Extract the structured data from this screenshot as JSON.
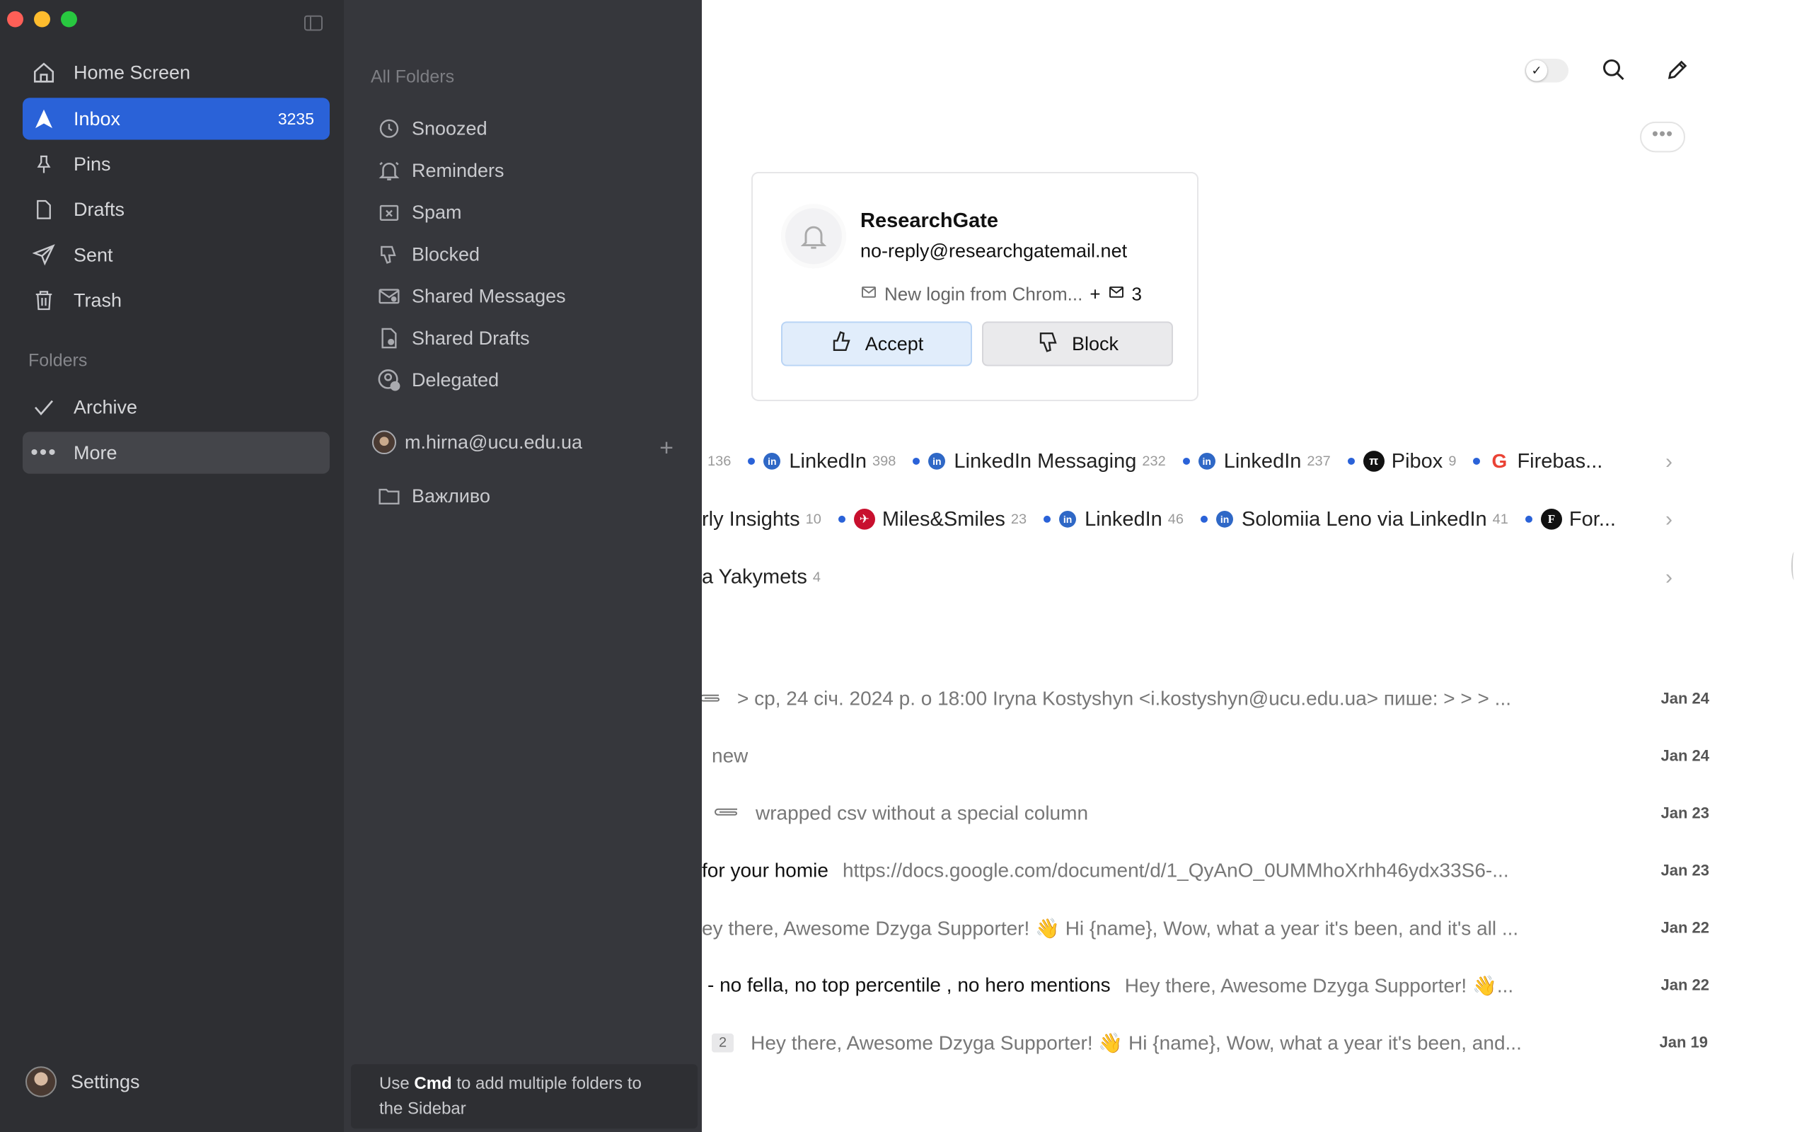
{
  "sidebar": {
    "nav": [
      {
        "label": "Home Screen",
        "icon": "home-icon"
      },
      {
        "label": "Inbox",
        "icon": "inbox-icon",
        "count": "3235"
      },
      {
        "label": "Pins",
        "icon": "pin-icon"
      },
      {
        "label": "Drafts",
        "icon": "drafts-icon"
      },
      {
        "label": "Sent",
        "icon": "sent-icon"
      },
      {
        "label": "Trash",
        "icon": "trash-icon"
      }
    ],
    "folders_label": "Folders",
    "folders": [
      {
        "label": "Archive",
        "icon": "check-icon"
      },
      {
        "label": "More",
        "icon": "more-icon"
      }
    ],
    "settings_label": "Settings",
    "accent": "#2a62d8"
  },
  "panel": {
    "title": "All Folders",
    "items": [
      {
        "label": "Snoozed",
        "icon": "clock-icon"
      },
      {
        "label": "Reminders",
        "icon": "bell-icon"
      },
      {
        "label": "Spam",
        "icon": "spam-icon"
      },
      {
        "label": "Blocked",
        "icon": "thumbs-down-icon"
      },
      {
        "label": "Shared Messages",
        "icon": "shared-messages-icon"
      },
      {
        "label": "Shared Drafts",
        "icon": "shared-drafts-icon"
      },
      {
        "label": "Delegated",
        "icon": "delegated-icon"
      }
    ],
    "account": "m.hirna@ucu.edu.ua",
    "add_symbol": "+",
    "custom_folder": "Важливо",
    "tip_prefix": "Use ",
    "tip_key": "Cmd",
    "tip_suffix": " to add multiple folders to",
    "tip_line2": "the Sidebar"
  },
  "card": {
    "name": "ResearchGate",
    "email": "no-reply@researchgatemail.net",
    "subject": "New login from Chrom...",
    "plus": "+",
    "count": "3",
    "accept_label": "Accept",
    "block_label": "Block"
  },
  "chip_rows": [
    [
      {
        "name": "",
        "count": "136"
      },
      {
        "name": "LinkedIn",
        "count": "398",
        "logo": "linkedin"
      },
      {
        "name": "LinkedIn Messaging",
        "count": "232",
        "logo": "linkedin"
      },
      {
        "name": "LinkedIn",
        "count": "237",
        "logo": "linkedin"
      },
      {
        "name": "Pibox",
        "count": "9",
        "logo": "pibox"
      },
      {
        "name": "Firebas...",
        "count": "",
        "logo": "google"
      }
    ],
    [
      {
        "name": "rly Insights",
        "count": "10"
      },
      {
        "name": "Miles&Smiles",
        "count": "23",
        "logo": "turkish"
      },
      {
        "name": "LinkedIn",
        "count": "46",
        "logo": "linkedin"
      },
      {
        "name": "Solomiia Leno via LinkedIn",
        "count": "41",
        "logo": "linkedin"
      },
      {
        "name": "For...",
        "count": "",
        "logo": "f"
      }
    ],
    [
      {
        "name": "a Yakymets",
        "count": "4"
      }
    ]
  ],
  "emails": [
    {
      "subject": "",
      "preview": "> ср, 24 січ. 2024 р. о 18:00 Iryna Kostyshyn <i.kostyshyn@ucu.edu.ua> пише: > > > ...",
      "date": "Jan 24",
      "attach": true
    },
    {
      "subject": "",
      "preview": "new",
      "date": "Jan 24"
    },
    {
      "subject": "",
      "preview": "wrapped csv without a special column",
      "date": "Jan 23",
      "attach": true
    },
    {
      "subject": "for your homie",
      "preview": "https://docs.google.com/document/d/1_QyAnO_0UMMhoXrhh46ydx33S6-...",
      "date": "Jan 23"
    },
    {
      "subject": "",
      "preview": "ey there, Awesome Dzyga Supporter! 👋 Hi {name}, Wow, what a year it's been, and it's all ...",
      "date": "Jan 22"
    },
    {
      "subject": "- no fella, no top percentile , no hero mentions",
      "preview": "Hey there, Awesome Dzyga Supporter! 👋...",
      "date": "Jan 22"
    },
    {
      "subject": "",
      "preview": "Hey there, Awesome Dzyga Supporter! 👋 Hi {name}, Wow, what a year it's been, and...",
      "date": "Jan 19",
      "badge": "2"
    }
  ],
  "toolbar": {
    "toggle_icon": "✓"
  }
}
